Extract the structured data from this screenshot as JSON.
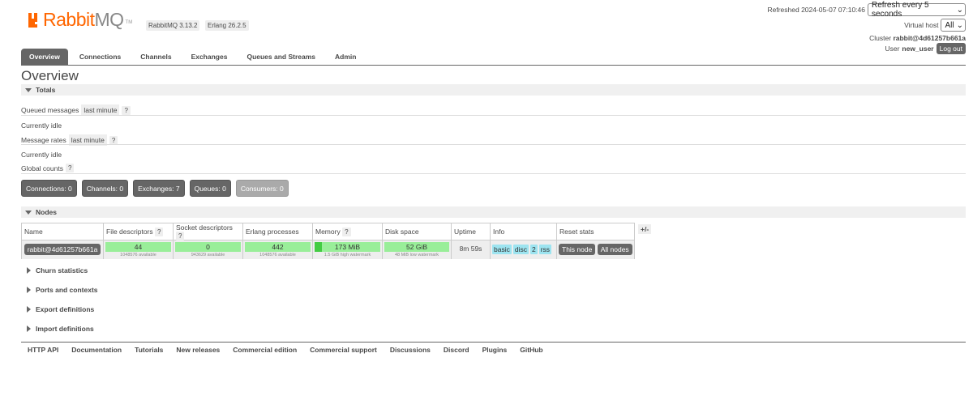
{
  "brand": {
    "rabbit": "Rabbit",
    "mq": "MQ",
    "tm": "TM"
  },
  "versions": {
    "rabbitmq": "RabbitMQ 3.13.2",
    "erlang": "Erlang 26.2.5"
  },
  "header": {
    "refreshed": "Refreshed 2024-05-07 07:10:46",
    "refresh_select": "Refresh every 5 seconds",
    "vhost_label": "Virtual host",
    "vhost_select": "All",
    "cluster_label": "Cluster",
    "cluster_name": "rabbit@4d61257b661a",
    "user_label": "User",
    "user_name": "new_user",
    "logout": "Log out"
  },
  "tabs": [
    {
      "label": "Overview",
      "active": true
    },
    {
      "label": "Connections"
    },
    {
      "label": "Channels"
    },
    {
      "label": "Exchanges"
    },
    {
      "label": "Queues and Streams"
    },
    {
      "label": "Admin"
    }
  ],
  "page_title": "Overview",
  "totals": {
    "heading": "Totals",
    "queued_messages": "Queued messages",
    "msg_rates": "Message rates",
    "last_minute": "last minute",
    "help": "?",
    "idle": "Currently idle",
    "global_counts": "Global counts",
    "counts": [
      "Connections: 0",
      "Channels: 0",
      "Exchanges: 7",
      "Queues: 0",
      "Consumers: 0"
    ]
  },
  "nodes": {
    "heading": "Nodes",
    "columns": [
      "Name",
      "File descriptors",
      "Socket descriptors",
      "Erlang processes",
      "Memory",
      "Disk space",
      "Uptime",
      "Info",
      "Reset stats"
    ],
    "help": "?",
    "plus_minus": "+/-",
    "row": {
      "name": "rabbit@4d61257b661a",
      "fd": "44",
      "fd_sub": "1048576 available",
      "sd": "0",
      "sd_sub": "943629 available",
      "ep": "442",
      "ep_sub": "1048576 available",
      "mem": "173 MiB",
      "mem_sub": "1.5 GiB high watermark",
      "mem_fraction": 0.11,
      "disk": "52 GiB",
      "disk_sub": "48 MiB low watermark",
      "uptime": "8m 59s",
      "info": [
        "basic",
        "disc",
        "2",
        "rss"
      ],
      "reset_this": "This node",
      "reset_all": "All nodes"
    }
  },
  "sections": [
    "Churn statistics",
    "Ports and contexts",
    "Export definitions",
    "Import definitions"
  ],
  "footer": [
    "HTTP API",
    "Documentation",
    "Tutorials",
    "New releases",
    "Commercial edition",
    "Commercial support",
    "Discussions",
    "Discord",
    "Plugins",
    "GitHub"
  ]
}
